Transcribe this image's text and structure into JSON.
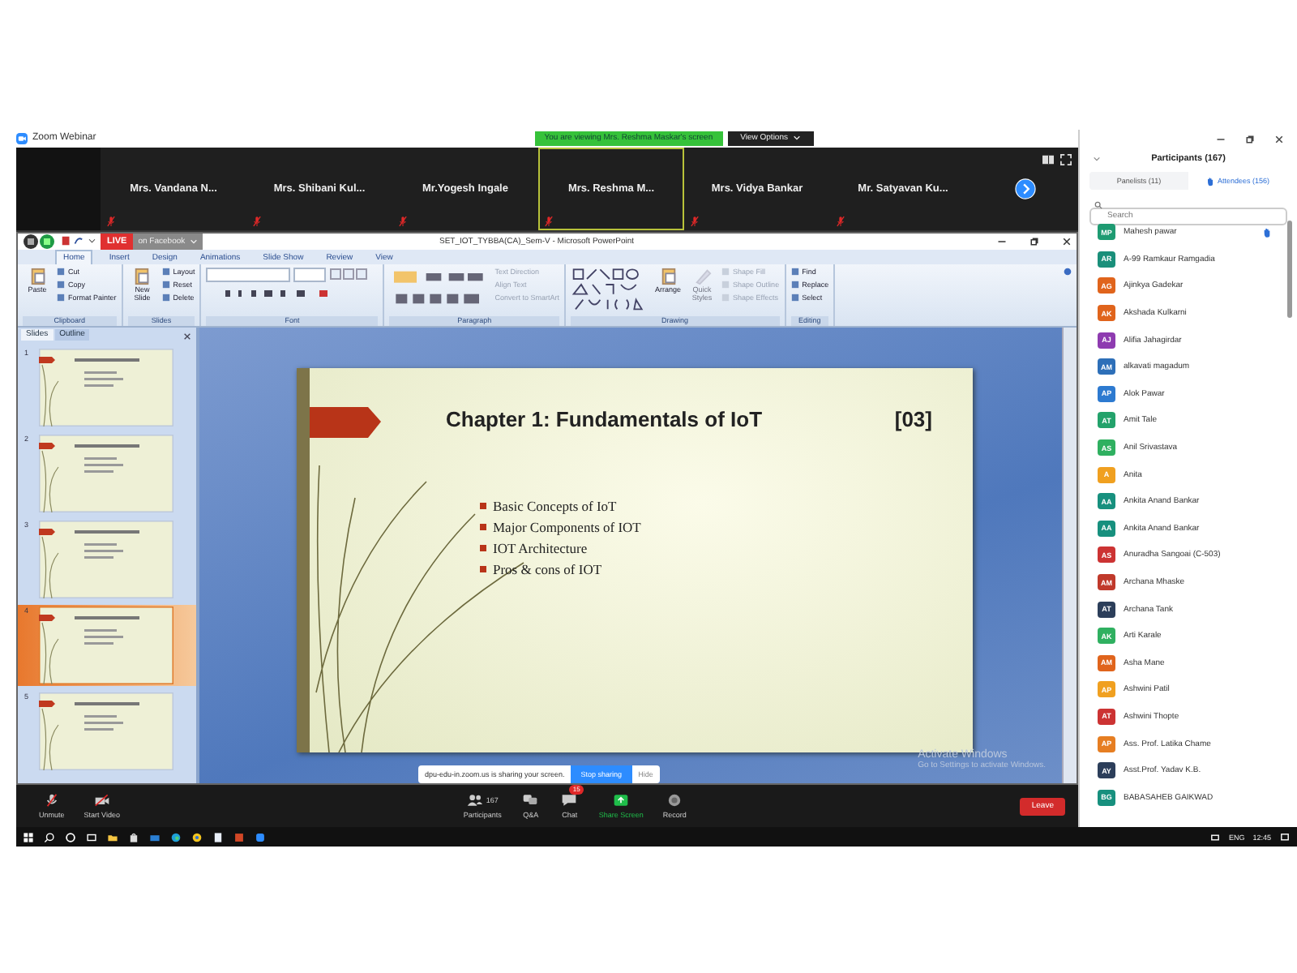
{
  "window": {
    "title": "Zoom Webinar"
  },
  "banner": {
    "text": "You are viewing Mrs. Reshma Maskar's screen",
    "options": "View Options"
  },
  "panelists": [
    {
      "name": "Mrs. Vandana N...",
      "speaking": false
    },
    {
      "name": "Mrs. Shibani Kul...",
      "speaking": false
    },
    {
      "name": "Mr.Yogesh Ingale",
      "speaking": false
    },
    {
      "name": "Mrs. Reshma M...",
      "speaking": true
    },
    {
      "name": "Mrs. Vidya Bankar",
      "speaking": false
    },
    {
      "name": "Mr. Satyavan Ku...",
      "speaking": false
    }
  ],
  "powerpoint": {
    "title": "SET_IOT_TYBBA(CA)_Sem-V - Microsoft PowerPoint",
    "live": {
      "badge": "LIVE",
      "text": "on Facebook"
    },
    "tabs": [
      {
        "label": "Home",
        "selected": true
      },
      {
        "label": "Insert",
        "selected": false
      },
      {
        "label": "Design",
        "selected": false
      },
      {
        "label": "Animations",
        "selected": false
      },
      {
        "label": "Slide Show",
        "selected": false
      },
      {
        "label": "Review",
        "selected": false
      },
      {
        "label": "View",
        "selected": false
      }
    ],
    "ribbon": [
      {
        "label": "Clipboard",
        "big": "Paste",
        "items": [
          {
            "label": "Cut",
            "disabled": false
          },
          {
            "label": "Copy",
            "disabled": false
          },
          {
            "label": "Format Painter",
            "disabled": false
          }
        ]
      },
      {
        "label": "Slides",
        "big": "New Slide",
        "items": [
          {
            "label": "Layout",
            "disabled": false
          },
          {
            "label": "Reset",
            "disabled": false
          },
          {
            "label": "Delete",
            "disabled": false
          }
        ]
      },
      {
        "label": "Font",
        "kind": "font"
      },
      {
        "label": "Paragraph",
        "kind": "paragraph",
        "items": [
          {
            "label": "Text Direction",
            "disabled": true
          },
          {
            "label": "Align Text",
            "disabled": true
          },
          {
            "label": "Convert to SmartArt",
            "disabled": true
          }
        ]
      },
      {
        "label": "Drawing",
        "kind": "drawing",
        "big": "Arrange",
        "big2": "Quick Styles",
        "items": [
          {
            "label": "Shape Fill",
            "disabled": true
          },
          {
            "label": "Shape Outline",
            "disabled": true
          },
          {
            "label": "Shape Effects",
            "disabled": true
          }
        ]
      },
      {
        "label": "Editing",
        "items": [
          {
            "label": "Find",
            "disabled": false
          },
          {
            "label": "Replace",
            "disabled": false
          },
          {
            "label": "Select",
            "disabled": false
          }
        ]
      }
    ],
    "pane_tabs": [
      {
        "label": "Slides",
        "selected": true
      },
      {
        "label": "Outline",
        "selected": false
      }
    ],
    "thumbnails": [
      {
        "number": "1",
        "selected": false
      },
      {
        "number": "2",
        "selected": false
      },
      {
        "number": "3",
        "selected": false
      },
      {
        "number": "4",
        "selected": true
      },
      {
        "number": "5",
        "selected": false
      }
    ],
    "slide": {
      "title": "Chapter 1: Fundamentals of IoT",
      "tag": "[03]",
      "bullets": [
        "Basic Concepts of IoT",
        "Major Components of IOT",
        "IOT Architecture",
        "Pros & cons of IOT"
      ]
    },
    "activation": {
      "title": "Activate Windows",
      "text": "Go to Settings to activate Windows."
    }
  },
  "share_bar": {
    "text": "dpu-edu-in.zoom.us is sharing your screen.",
    "stop": "Stop sharing",
    "hide": "Hide"
  },
  "toolbar": [
    {
      "label": "Unmute",
      "kind": "mic"
    },
    {
      "label": "Start Video",
      "kind": "video"
    },
    {
      "label": "Participants",
      "kind": "participants",
      "count": "167"
    },
    {
      "label": "Q&A",
      "kind": "qa"
    },
    {
      "label": "Chat",
      "kind": "chat",
      "badge": "15"
    },
    {
      "label": "Share Screen",
      "kind": "share"
    },
    {
      "label": "Record",
      "kind": "record"
    }
  ],
  "leave": "Leave",
  "participants": {
    "title": "Participants (167)",
    "tabs": [
      {
        "label": "Panelists (11)",
        "selected": false
      },
      {
        "label": "Attendees (156)",
        "selected": true
      }
    ],
    "search": {
      "placeholder": "Search"
    },
    "list": [
      {
        "initials": "MP",
        "name": "Mahesh pawar",
        "color": "#1e9b72",
        "hand": true
      },
      {
        "initials": "AR",
        "name": "A-99 Ramkaur Ramgadia",
        "color": "#1a8f7a",
        "hand": false
      },
      {
        "initials": "AG",
        "name": "Ajinkya Gadekar",
        "color": "#e0641c",
        "hand": false
      },
      {
        "initials": "AK",
        "name": "Akshada Kulkarni",
        "color": "#e0641c",
        "hand": false
      },
      {
        "initials": "AJ",
        "name": "Alifia Jahagirdar",
        "color": "#8e3bb0",
        "hand": false
      },
      {
        "initials": "AM",
        "name": "alkavati magadum",
        "color": "#2d6fb8",
        "hand": false
      },
      {
        "initials": "AP",
        "name": "Alok Pawar",
        "color": "#2d7ad0",
        "hand": false
      },
      {
        "initials": "AT",
        "name": "Amit Tale",
        "color": "#23a26b",
        "hand": false
      },
      {
        "initials": "AS",
        "name": "Anil Srivastava",
        "color": "#2fb060",
        "hand": false
      },
      {
        "initials": "A",
        "name": "Anita",
        "color": "#f0a020",
        "hand": false
      },
      {
        "initials": "AA",
        "name": "Ankita Anand Bankar",
        "color": "#17907e",
        "hand": false
      },
      {
        "initials": "AA",
        "name": "Ankita Anand Bankar",
        "color": "#17907e",
        "hand": false
      },
      {
        "initials": "AS",
        "name": "Anuradha Sangoai (C-503)",
        "color": "#cc3333",
        "hand": false
      },
      {
        "initials": "AM",
        "name": "Archana Mhaske",
        "color": "#c0392b",
        "hand": false
      },
      {
        "initials": "AT",
        "name": "Archana Tank",
        "color": "#2c3e5a",
        "hand": false
      },
      {
        "initials": "AK",
        "name": "Arti Karale",
        "color": "#2fb060",
        "hand": false
      },
      {
        "initials": "AM",
        "name": "Asha Mane",
        "color": "#e0641c",
        "hand": false
      },
      {
        "initials": "AP",
        "name": "Ashwini Patil",
        "color": "#f0a020",
        "hand": false
      },
      {
        "initials": "AT",
        "name": "Ashwini Thopte",
        "color": "#cc3333",
        "hand": false
      },
      {
        "initials": "AP",
        "name": "Ass. Prof. Latika Chame",
        "color": "#e67e22",
        "hand": false
      },
      {
        "initials": "AY",
        "name": "Asst.Prof. Yadav K.B.",
        "color": "#2c3e5a",
        "hand": false
      },
      {
        "initials": "BG",
        "name": "BABASAHEB GAIKWAD",
        "color": "#17907e",
        "hand": false
      }
    ]
  },
  "taskbar": {
    "language": "ENG",
    "time": "12:45"
  }
}
